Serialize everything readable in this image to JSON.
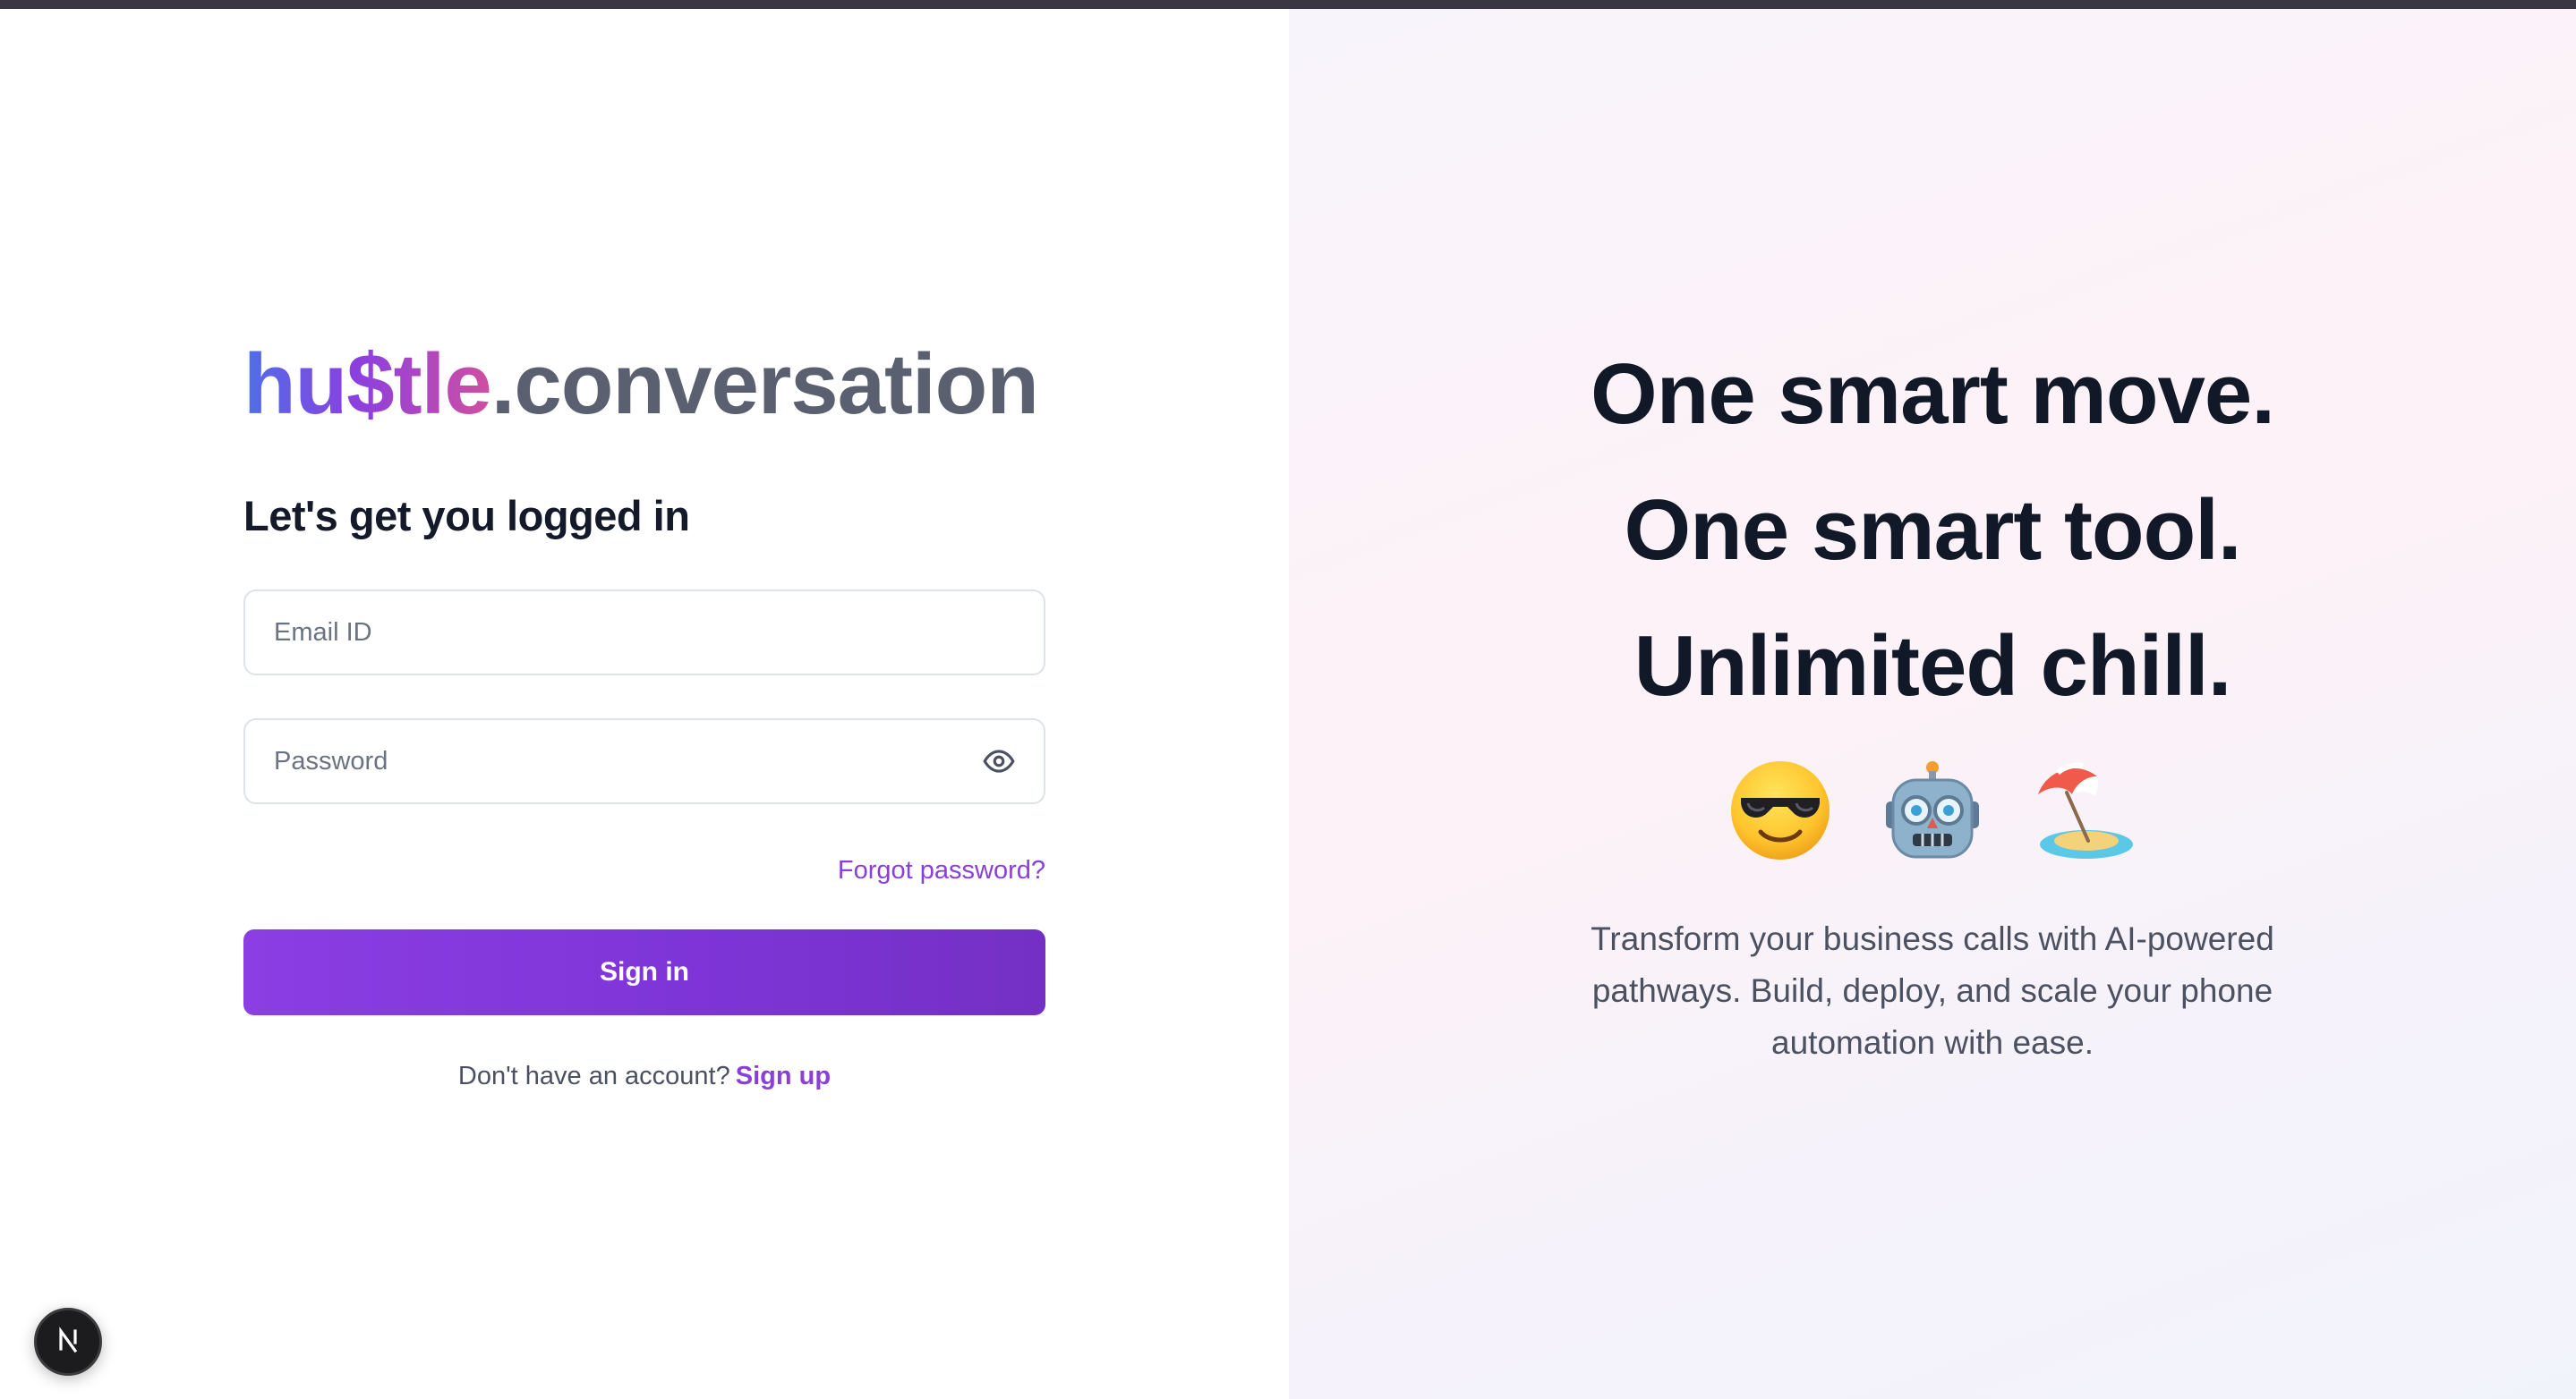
{
  "brand": {
    "name_part": "hu$tle",
    "suffix": ".conversation"
  },
  "login": {
    "heading": "Let's get you logged in",
    "email_placeholder": "Email ID",
    "password_placeholder": "Password",
    "forgot_label": "Forgot password?",
    "signin_label": "Sign in",
    "signup_prompt": "Don't have an account?",
    "signup_label": "Sign up"
  },
  "hero": {
    "lines": [
      "One smart move.",
      "One smart tool.",
      "Unlimited chill."
    ],
    "emojis": [
      "smiling-face-with-sunglasses-icon",
      "robot-icon",
      "beach-umbrella-icon"
    ],
    "description": "Transform your business calls with AI-powered pathways. Build, deploy, and scale your phone automation with ease."
  },
  "dev": {
    "badge_icon": "nextjs-icon"
  },
  "colors": {
    "accent": "#8b3fd9",
    "button_start": "#8a3ee3",
    "button_end": "#7430c4",
    "heading": "#111827",
    "muted": "#4b5160"
  }
}
